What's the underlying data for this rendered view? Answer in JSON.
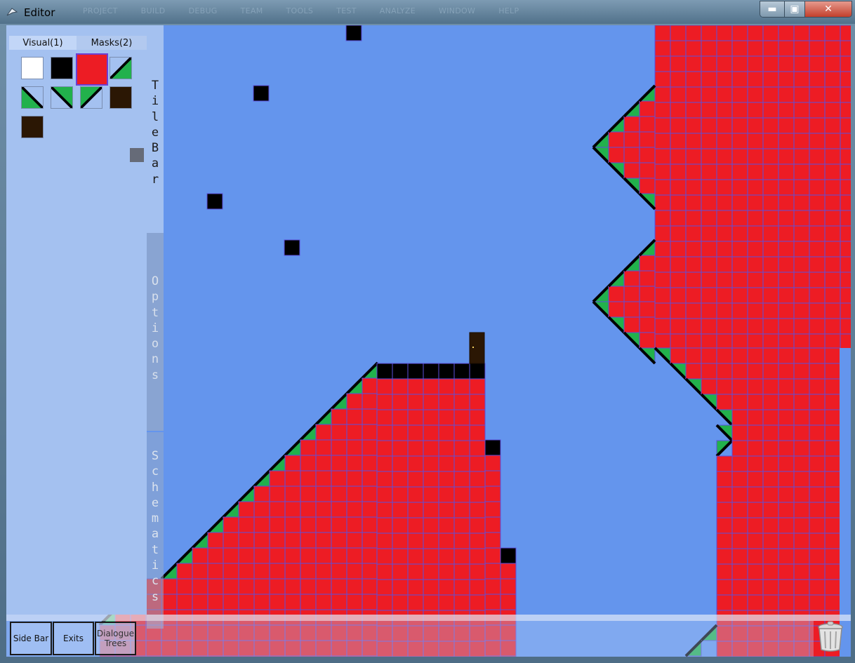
{
  "window": {
    "title": "Editor",
    "menu": [
      "PROJECT",
      "BUILD",
      "DEBUG",
      "TEAM",
      "TOOLS",
      "TEST",
      "ANALYZE",
      "WINDOW",
      "HELP"
    ],
    "min_label": "▬",
    "max_label": "▣",
    "close_label": "✕"
  },
  "tile_panel": {
    "tabs": [
      {
        "label": "Visual(1)"
      },
      {
        "label": "Masks(2)"
      }
    ],
    "selected_swatch": "red-tile",
    "swatches": [
      "white-tile",
      "black-tile",
      "red-tile",
      "slope-up-green",
      "slope-down-green",
      "slope-down-green-alt",
      "slope-up-green-alt",
      "brown-tile",
      "brown-tile-alt"
    ]
  },
  "side_tabs": {
    "tilebar": "TileBar",
    "options": "Options",
    "schematics": "Schematics"
  },
  "bottom_bar": {
    "side_bar": "Side Bar",
    "exits": "Exits",
    "dialogue_line1": "Dialogue",
    "dialogue_line2": "Trees"
  },
  "colors": {
    "sky": "#6495ed",
    "solid": "#ed1c24",
    "grid": "#5b4fdc",
    "slope_green": "#22b14c",
    "block": "#000000",
    "door": "#2b1704"
  }
}
